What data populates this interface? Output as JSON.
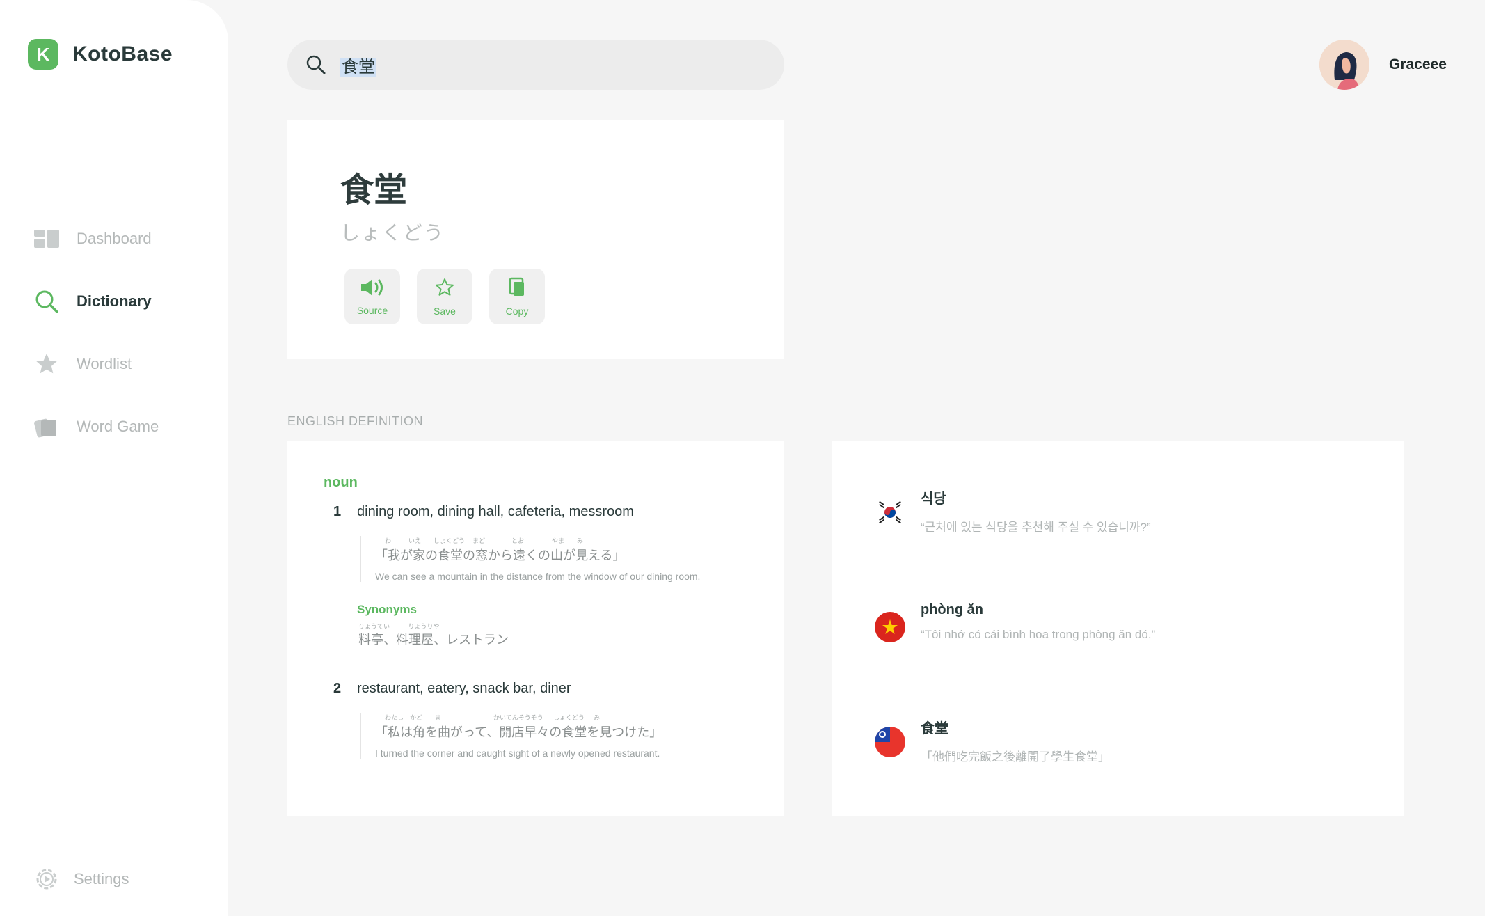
{
  "app": {
    "logo_letter": "K",
    "name": "KotoBase",
    "accent": "#5cb860"
  },
  "sidebar": {
    "items": [
      {
        "label": "Dashboard",
        "icon": "dashboard-icon",
        "active": false
      },
      {
        "label": "Dictionary",
        "icon": "search-icon",
        "active": true
      },
      {
        "label": "Wordlist",
        "icon": "star-icon",
        "active": false
      },
      {
        "label": "Word Game",
        "icon": "cards-icon",
        "active": false
      }
    ],
    "settings_label": "Settings"
  },
  "search": {
    "value": "食堂"
  },
  "user": {
    "name": "Graceee"
  },
  "entry": {
    "word": "食堂",
    "reading": "しょくどう",
    "actions": [
      {
        "label": "Source",
        "icon": "speaker-icon"
      },
      {
        "label": "Save",
        "icon": "star-outline-icon"
      },
      {
        "label": "Copy",
        "icon": "copy-icon"
      }
    ]
  },
  "definition": {
    "section_label": "ENGLISH DEFINITION",
    "pos": "noun",
    "senses": [
      {
        "number": "1",
        "gloss": "dining room, dining hall, cafeteria, messroom",
        "example_ruby": [
          "わ",
          "いえ",
          "しょくどう",
          "まど",
          "とお",
          "やま",
          "み"
        ],
        "example_jp": "「我が家の食堂の窓から遠くの山が見える」",
        "example_en": "We can see a mountain in the distance from the window of our dining room.",
        "synonyms_label": "Synonyms",
        "synonyms_ruby": [
          "りょうてい",
          "りょうりや"
        ],
        "synonyms": "料亭、料理屋、レストラン"
      },
      {
        "number": "2",
        "gloss": "restaurant, eatery, snack bar, diner",
        "example_ruby": [
          "わたし",
          "かど",
          "ま",
          "かいてんそうそう",
          "しょくどう",
          "み"
        ],
        "example_jp": "「私は角を曲がって、開店早々の食堂を見つけた」",
        "example_en": "I turned the corner and caught sight of a newly opened restaurant."
      }
    ]
  },
  "translations": [
    {
      "flag": "korea-flag-icon",
      "word": "식당",
      "example": "“근처에 있는 식당을 추천해 주실 수 있습니까?”"
    },
    {
      "flag": "vietnam-flag-icon",
      "word": "phòng ăn",
      "example": "“Tôi nhớ có cái bình hoa trong phòng ăn đó.”"
    },
    {
      "flag": "taiwan-flag-icon",
      "word": "食堂",
      "example": "「他們吃完飯之後離開了學生食堂」"
    }
  ]
}
